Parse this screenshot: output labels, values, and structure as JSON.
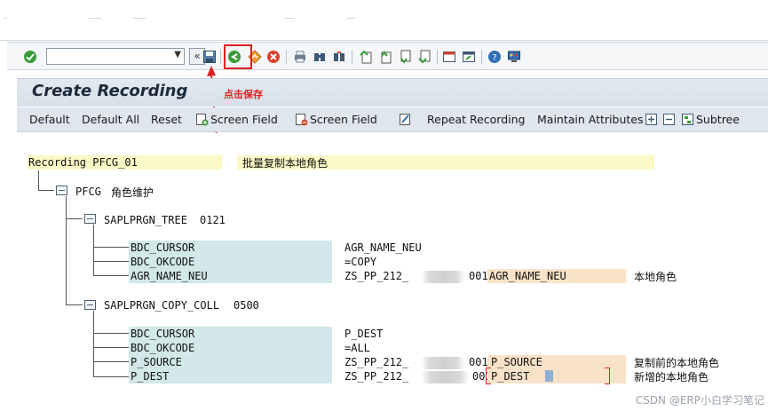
{
  "toolbar": {
    "command_placeholder": ""
  },
  "screen": {
    "title": "Create Recording",
    "annotation": "点击保存"
  },
  "app_toolbar": {
    "default": "Default",
    "default_all": "Default All",
    "reset": "Reset",
    "screen_field_1": "Screen Field",
    "screen_field_2": "Screen Field",
    "repeat_recording": "Repeat Recording",
    "maintain_attributes": "Maintain Attributes",
    "subtree": "Subtree"
  },
  "recording": {
    "name": "Recording PFCG_01",
    "description": "批量复制本地角色",
    "transaction": {
      "code": "PFCG",
      "description": "角色维护"
    },
    "screens": [
      {
        "program": "SAPLPRGN_TREE",
        "dynpro": "0121",
        "fields": [
          {
            "name": "BDC_CURSOR",
            "value": "AGR_NAME_NEU",
            "param": "",
            "comment": ""
          },
          {
            "name": "BDC_OKCODE",
            "value": "=COPY",
            "param": "",
            "comment": ""
          },
          {
            "name": "AGR_NAME_NEU",
            "value_prefix": "ZS_PP_212_",
            "value_suffix": "001",
            "param": "AGR_NAME_NEU",
            "comment": "本地角色"
          }
        ]
      },
      {
        "program": "SAPLPRGN_COPY_COLL",
        "dynpro": "0500",
        "fields": [
          {
            "name": "BDC_CURSOR",
            "value": "P_DEST",
            "param": "",
            "comment": ""
          },
          {
            "name": "BDC_OKCODE",
            "value": "=ALL",
            "param": "",
            "comment": ""
          },
          {
            "name": "P_SOURCE",
            "value_prefix": "ZS_PP_212_",
            "value_suffix": "001",
            "param": "P_SOURCE",
            "comment": "复制前的本地角色"
          },
          {
            "name": "P_DEST",
            "value_prefix": "ZS_PP_212_",
            "value_suffix": "001",
            "param": "P_DEST",
            "comment": "新增的本地角色"
          }
        ]
      }
    ]
  },
  "watermark": "CSDN @ERP小白学习笔记",
  "colors": {
    "highlight_red": "#e02020",
    "yellow_bg": "#fbf8c6",
    "teal_bg": "#d3e8e8",
    "peach_bg": "#f8e2c8"
  }
}
